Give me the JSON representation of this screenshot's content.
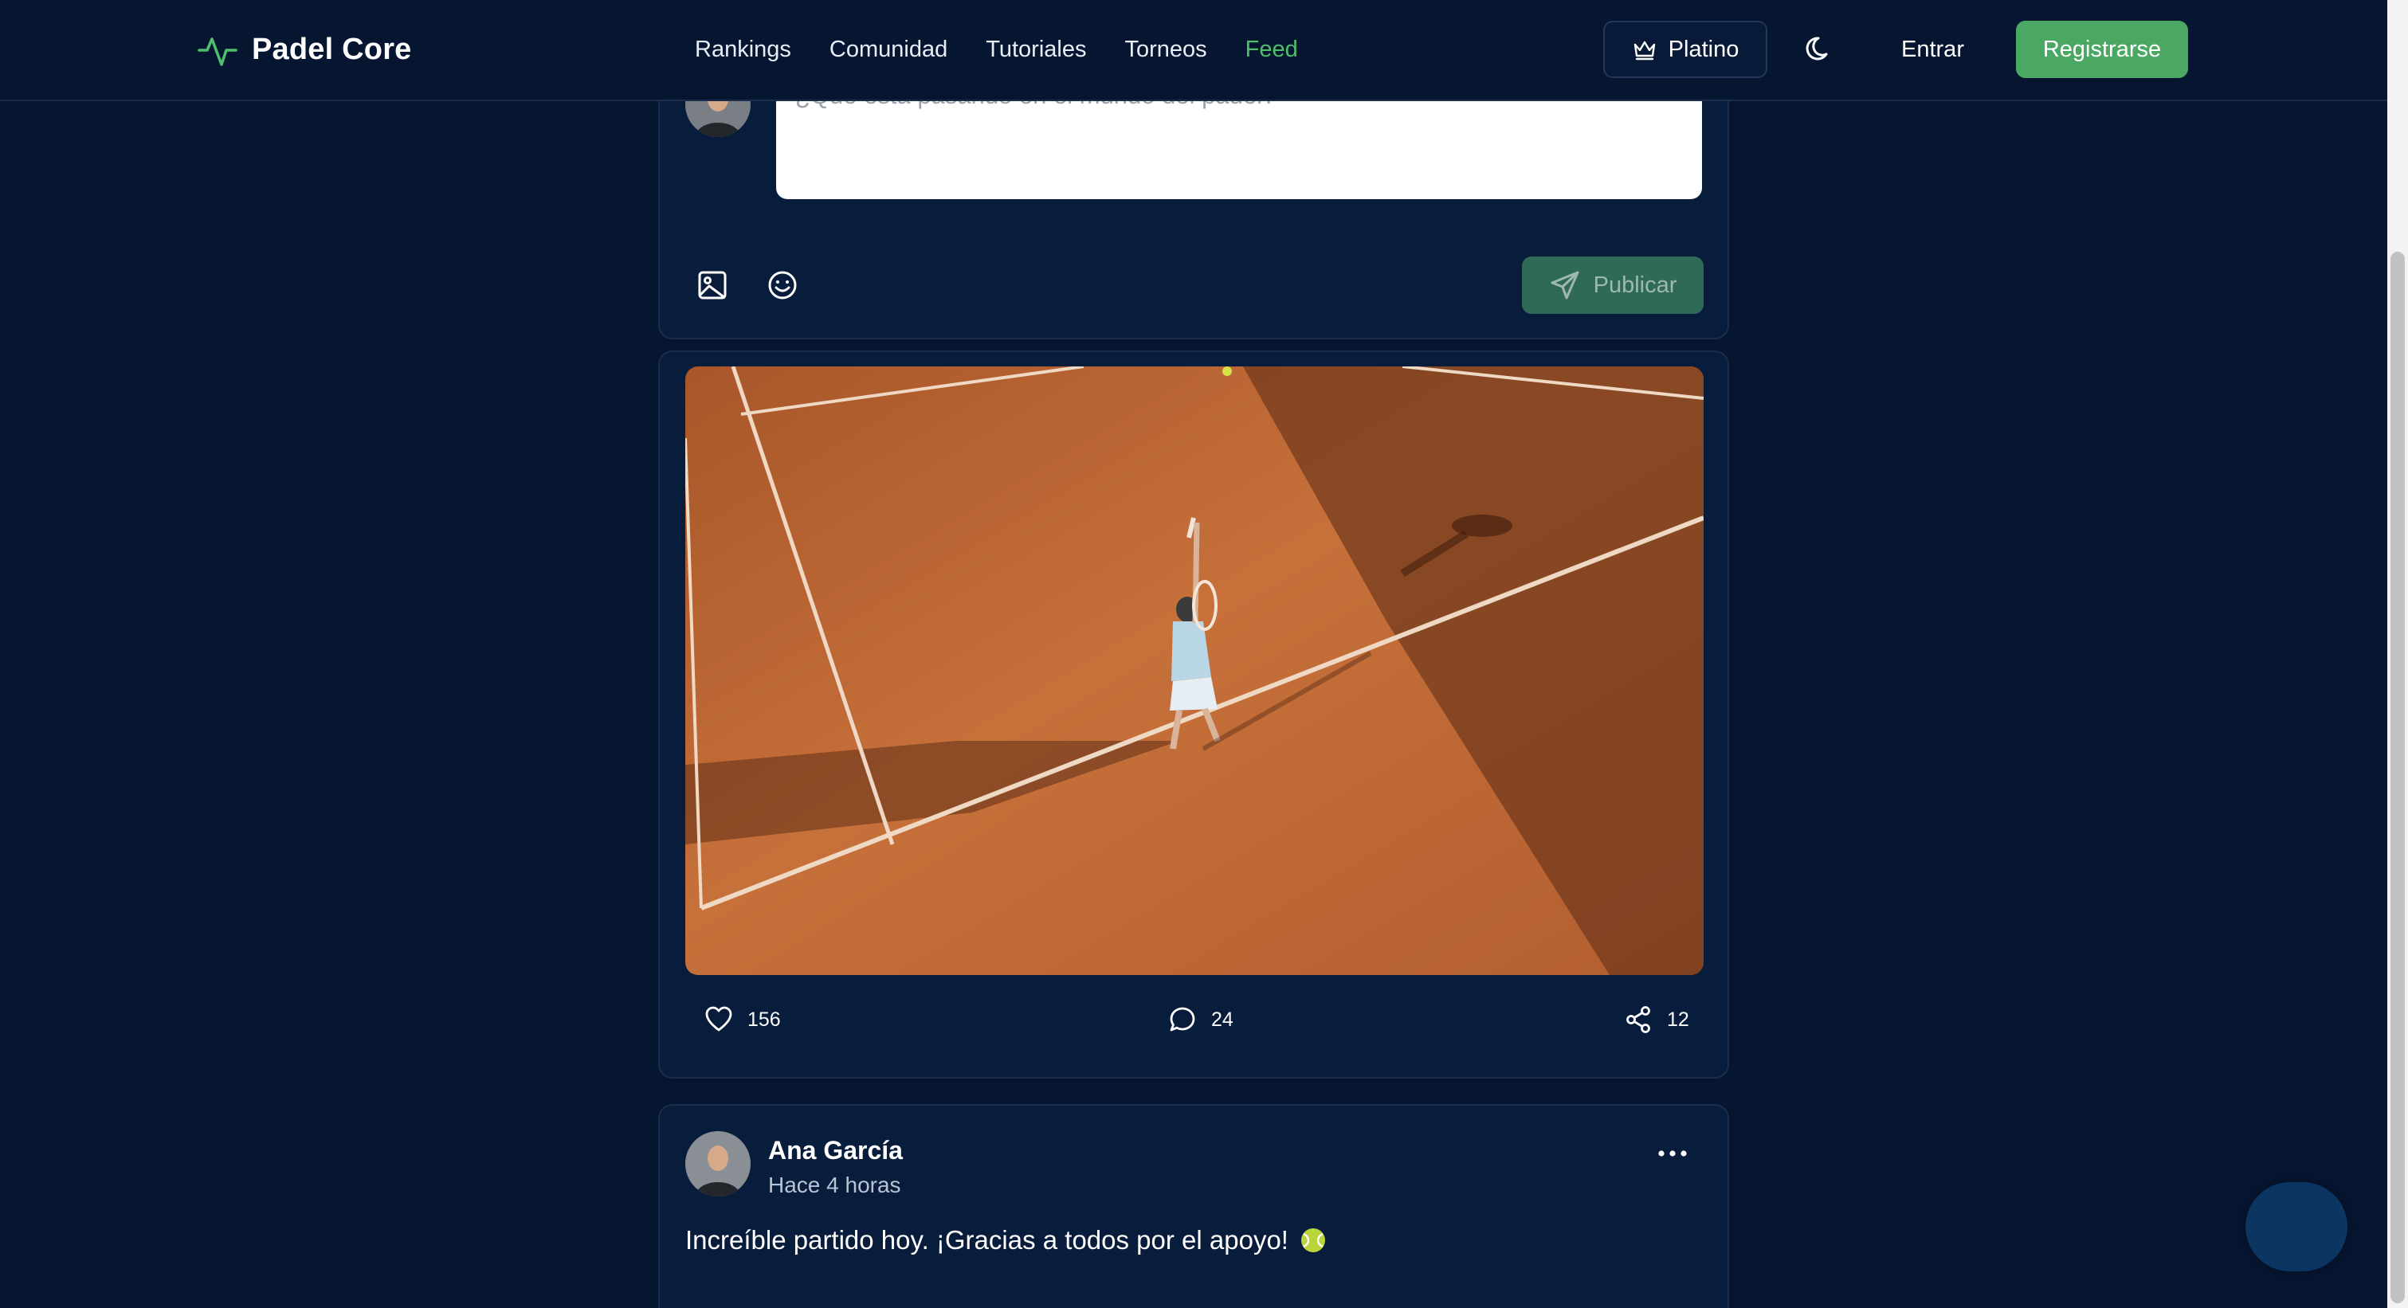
{
  "header": {
    "brand": "Padel Core",
    "nav": [
      "Rankings",
      "Comunidad",
      "Tutoriales",
      "Torneos",
      "Feed"
    ],
    "active_nav": "Feed",
    "platino_label": "Platino",
    "login_label": "Entrar",
    "register_label": "Registrarse"
  },
  "composer": {
    "placeholder": "¿Qué está pasando en el mundo del padel?",
    "publish_label": "Publicar"
  },
  "posts": [
    {
      "likes": "156",
      "comments": "24",
      "shares": "12"
    },
    {
      "author": "Ana García",
      "time": "Hace 4 horas",
      "text": "Increíble partido hoy. ¡Gracias a todos por el apoyo!",
      "emoji": "tennis-ball-icon"
    }
  ],
  "colors": {
    "background": "#061631",
    "card": "#081c3b",
    "accent": "#4aa863",
    "active_nav": "#4fbe6d"
  }
}
